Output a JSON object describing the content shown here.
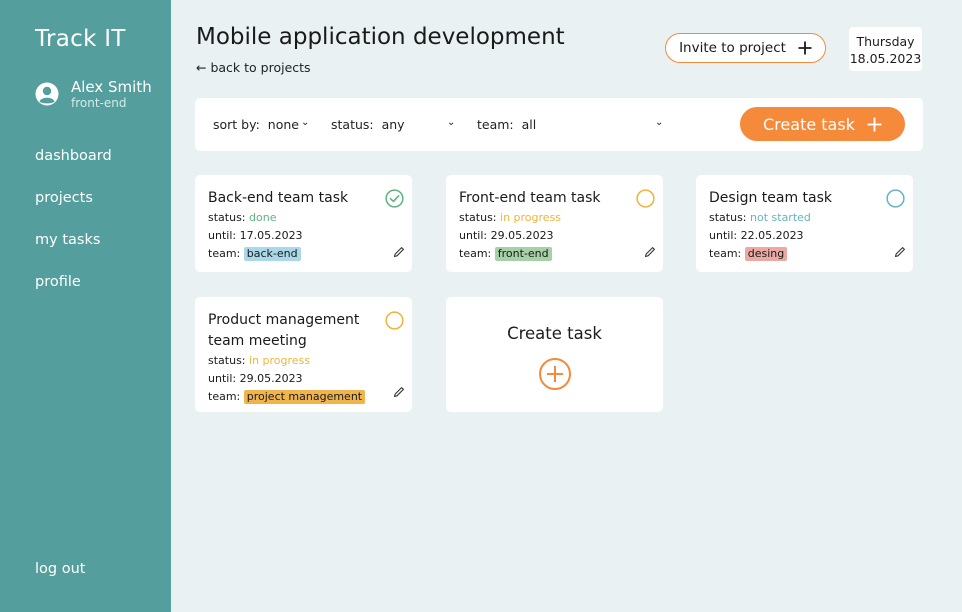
{
  "sidebar": {
    "brand": "Track IT",
    "user": {
      "name": "Alex Smith",
      "role": "front-end"
    },
    "nav": [
      {
        "label": "dashboard"
      },
      {
        "label": "projects"
      },
      {
        "label": "my tasks"
      },
      {
        "label": "profile"
      }
    ],
    "logout": "log out"
  },
  "header": {
    "title": "Mobile application development",
    "back": "← back to projects",
    "invite_label": "Invite to project",
    "date": {
      "weekday": "Thursday",
      "date": "18.05.2023"
    }
  },
  "toolbar": {
    "sort": {
      "label": "sort by:",
      "value": "none"
    },
    "status": {
      "label": "status:",
      "value": "any"
    },
    "team": {
      "label": "team:",
      "value": "all"
    },
    "create_label": "Create task"
  },
  "tasks": [
    {
      "title": "Back-end team task",
      "status_label": "status:",
      "status": "done",
      "until_label": "until:",
      "until": "17.05.2023",
      "team_label": "team:",
      "team": "back-end",
      "status_color": "#5fb381",
      "team_color": "#a9d8e8",
      "icon": "check-circle-icon"
    },
    {
      "title": "Front-end team task",
      "status_label": "status:",
      "status": "in progress",
      "until_label": "until:",
      "until": "29.05.2023",
      "team_label": "team:",
      "team": "front-end",
      "status_color": "#f0b43a",
      "team_color": "#a6d0a5",
      "icon": "circle-icon"
    },
    {
      "title": "Design team task",
      "status_label": "status:",
      "status": "not started",
      "until_label": "until:",
      "until": "22.05.2023",
      "team_label": "team:",
      "team": "desing",
      "status_color": "#65b5bf",
      "team_color": "#eba9a4",
      "icon": "circle-icon"
    },
    {
      "title": "Product management team meeting",
      "status_label": "status:",
      "status": "in progress",
      "until_label": "until:",
      "until": "29.05.2023",
      "team_label": "team:",
      "team": "project management",
      "status_color": "#f0b43a",
      "team_color": "#efb44c",
      "icon": "circle-icon"
    }
  ],
  "create_card": {
    "label": "Create task"
  },
  "colors": {
    "sidebar": "#549f9d",
    "accent": "#f58a3a",
    "background": "#e9f1f2"
  }
}
